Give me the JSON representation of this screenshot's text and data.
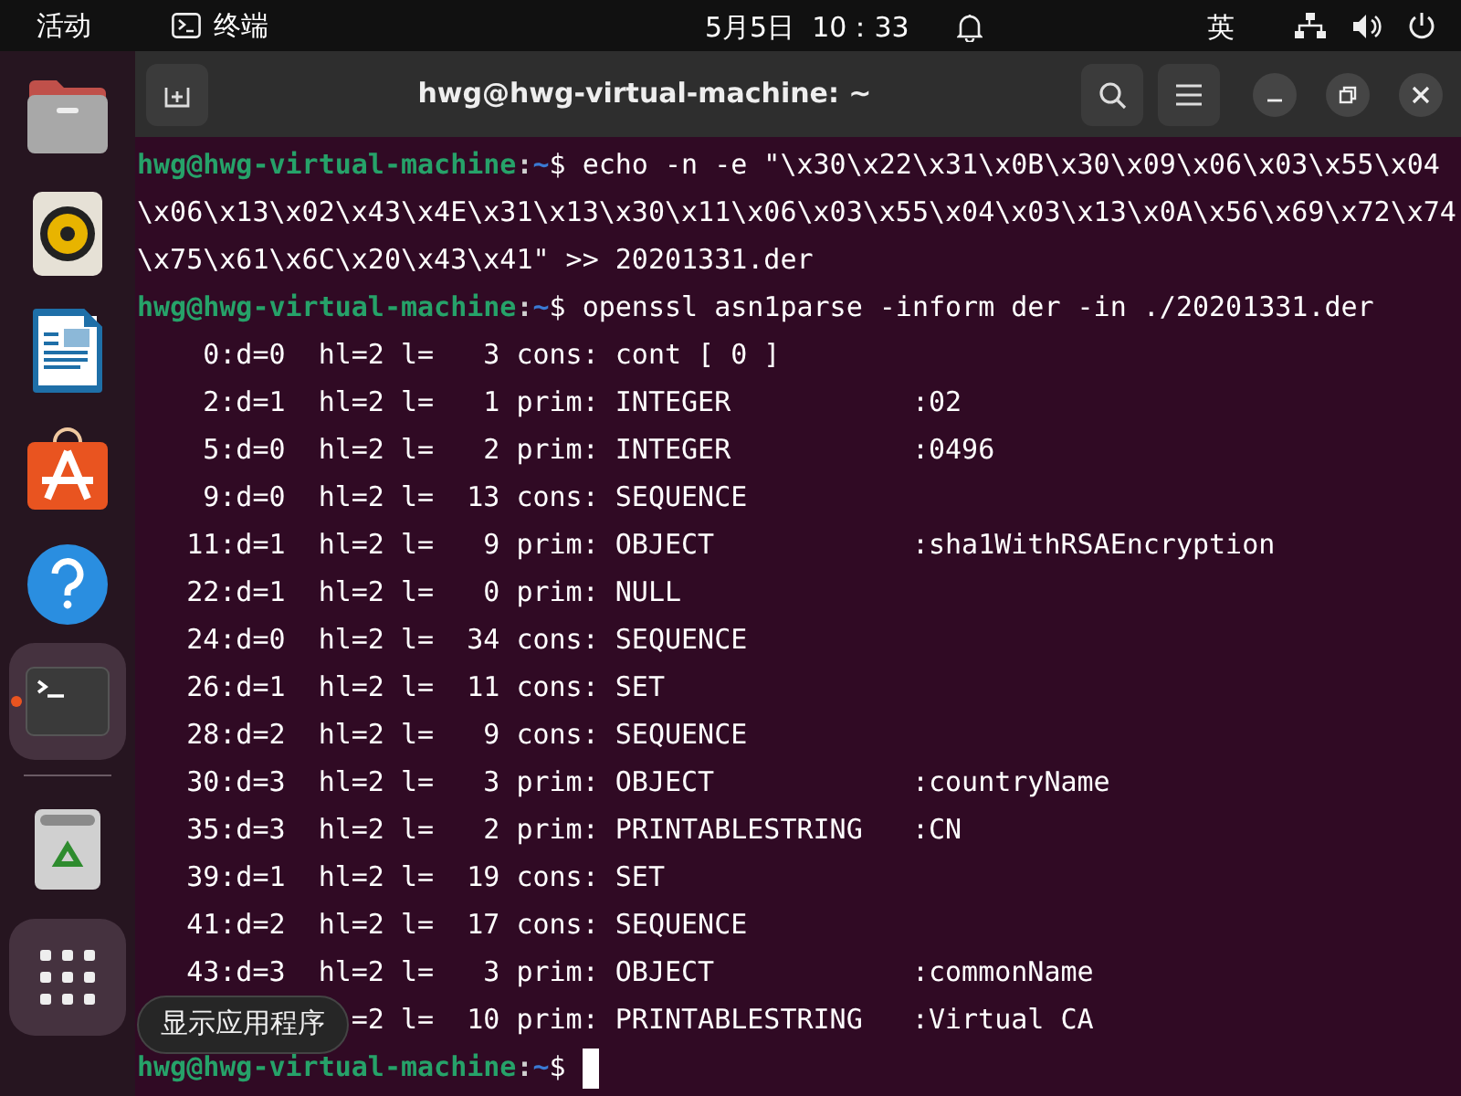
{
  "top_bar": {
    "activities": "活动",
    "app_name": "终端",
    "clock": "5月5日  10：33",
    "input_method": "英"
  },
  "dock": {
    "items": [
      {
        "kind": "files",
        "running": false
      },
      {
        "kind": "music",
        "running": false
      },
      {
        "kind": "writer",
        "running": false
      },
      {
        "kind": "store",
        "running": false
      },
      {
        "kind": "help",
        "running": false
      },
      {
        "kind": "terminal",
        "running": true
      },
      {
        "kind": "trash",
        "running": false
      },
      {
        "kind": "apps",
        "running": false
      }
    ],
    "tooltip": "显示应用程序"
  },
  "terminal": {
    "title": "hwg@hwg-virtual-machine: ~",
    "lines": [
      {
        "kind": "prompt",
        "user": "hwg@hwg-virtual-machine",
        "separator": ":",
        "path": "~",
        "symbol": "$",
        "command": "echo -n -e \"\\x30\\x22\\x31\\x0B\\x30\\x09\\x06\\x03\\x55\\x04\\x06\\x13\\x02\\x43\\x4E\\x31\\x13\\x30\\x11\\x06\\x03\\x55\\x04\\x03\\x13\\x0A\\x56\\x69\\x72\\x74\\x75\\x61\\x6C\\x20\\x43\\x41\" >> 20201331.der"
      },
      {
        "kind": "prompt",
        "user": "hwg@hwg-virtual-machine",
        "separator": ":",
        "path": "~",
        "symbol": "$",
        "command": "openssl asn1parse -inform der -in ./20201331.der"
      },
      {
        "kind": "output",
        "text": "    0:d=0  hl=2 l=   3 cons: cont [ 0 ]"
      },
      {
        "kind": "output",
        "text": "    2:d=1  hl=2 l=   1 prim: INTEGER           :02"
      },
      {
        "kind": "output",
        "text": "    5:d=0  hl=2 l=   2 prim: INTEGER           :0496"
      },
      {
        "kind": "output",
        "text": "    9:d=0  hl=2 l=  13 cons: SEQUENCE"
      },
      {
        "kind": "output",
        "text": "   11:d=1  hl=2 l=   9 prim: OBJECT            :sha1WithRSAEncryption"
      },
      {
        "kind": "output",
        "text": "   22:d=1  hl=2 l=   0 prim: NULL"
      },
      {
        "kind": "output",
        "text": "   24:d=0  hl=2 l=  34 cons: SEQUENCE"
      },
      {
        "kind": "output",
        "text": "   26:d=1  hl=2 l=  11 cons: SET"
      },
      {
        "kind": "output",
        "text": "   28:d=2  hl=2 l=   9 cons: SEQUENCE"
      },
      {
        "kind": "output",
        "text": "   30:d=3  hl=2 l=   3 prim: OBJECT            :countryName"
      },
      {
        "kind": "output",
        "text": "   35:d=3  hl=2 l=   2 prim: PRINTABLESTRING   :CN"
      },
      {
        "kind": "output",
        "text": "   39:d=1  hl=2 l=  19 cons: SET"
      },
      {
        "kind": "output",
        "text": "   41:d=2  hl=2 l=  17 cons: SEQUENCE"
      },
      {
        "kind": "output",
        "text": "   43:d=3  hl=2 l=   3 prim: OBJECT            :commonName"
      },
      {
        "kind": "covered",
        "text": "=2 l=  10 prim: PRINTABLESTRING   :Virtual CA"
      },
      {
        "kind": "prompt",
        "user": "hwg@hwg-virtual-machine",
        "separator": ":",
        "path": "~",
        "symbol": "$",
        "cursor": true
      }
    ]
  }
}
